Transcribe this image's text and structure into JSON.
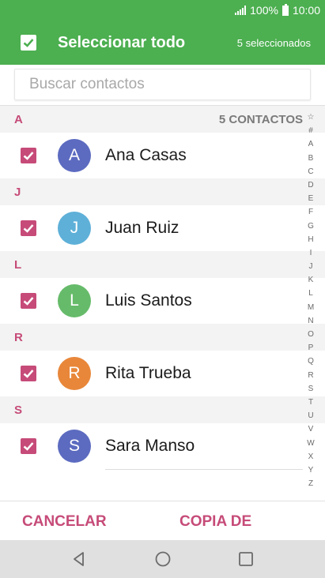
{
  "status_bar": {
    "battery": "100%",
    "time": "10:00"
  },
  "app_bar": {
    "title": "Seleccionar todo",
    "selected_count": "5 seleccionados"
  },
  "search": {
    "placeholder": "Buscar contactos",
    "value": ""
  },
  "list": {
    "contacts_count": "5 CONTACTOS",
    "sections": [
      {
        "letter": "A",
        "contact": {
          "initial": "A",
          "name": "Ana Casas",
          "color": "#5c6bc0",
          "checked": true
        }
      },
      {
        "letter": "J",
        "contact": {
          "initial": "J",
          "name": "Juan Ruiz",
          "color": "#5eb0d8",
          "checked": true
        }
      },
      {
        "letter": "L",
        "contact": {
          "initial": "L",
          "name": "Luis Santos",
          "color": "#66bb6a",
          "checked": true
        }
      },
      {
        "letter": "R",
        "contact": {
          "initial": "R",
          "name": "Rita Trueba",
          "color": "#e8873a",
          "checked": true
        }
      },
      {
        "letter": "S",
        "contact": {
          "initial": "S",
          "name": "Sara Manso",
          "color": "#5c6bc0",
          "checked": true
        }
      }
    ]
  },
  "index_bar": [
    "☆",
    "#",
    "A",
    "B",
    "C",
    "D",
    "E",
    "F",
    "G",
    "H",
    "I",
    "J",
    "K",
    "L",
    "M",
    "N",
    "O",
    "P",
    "Q",
    "R",
    "S",
    "T",
    "U",
    "V",
    "W",
    "X",
    "Y",
    "Z"
  ],
  "buttons": {
    "cancel": "CANCELAR",
    "copy_from": "COPIA DE"
  },
  "colors": {
    "app_bar": "#4caf50",
    "accent": "#c64b78"
  },
  "nav_icons": [
    "back-icon",
    "home-icon",
    "recents-icon"
  ]
}
